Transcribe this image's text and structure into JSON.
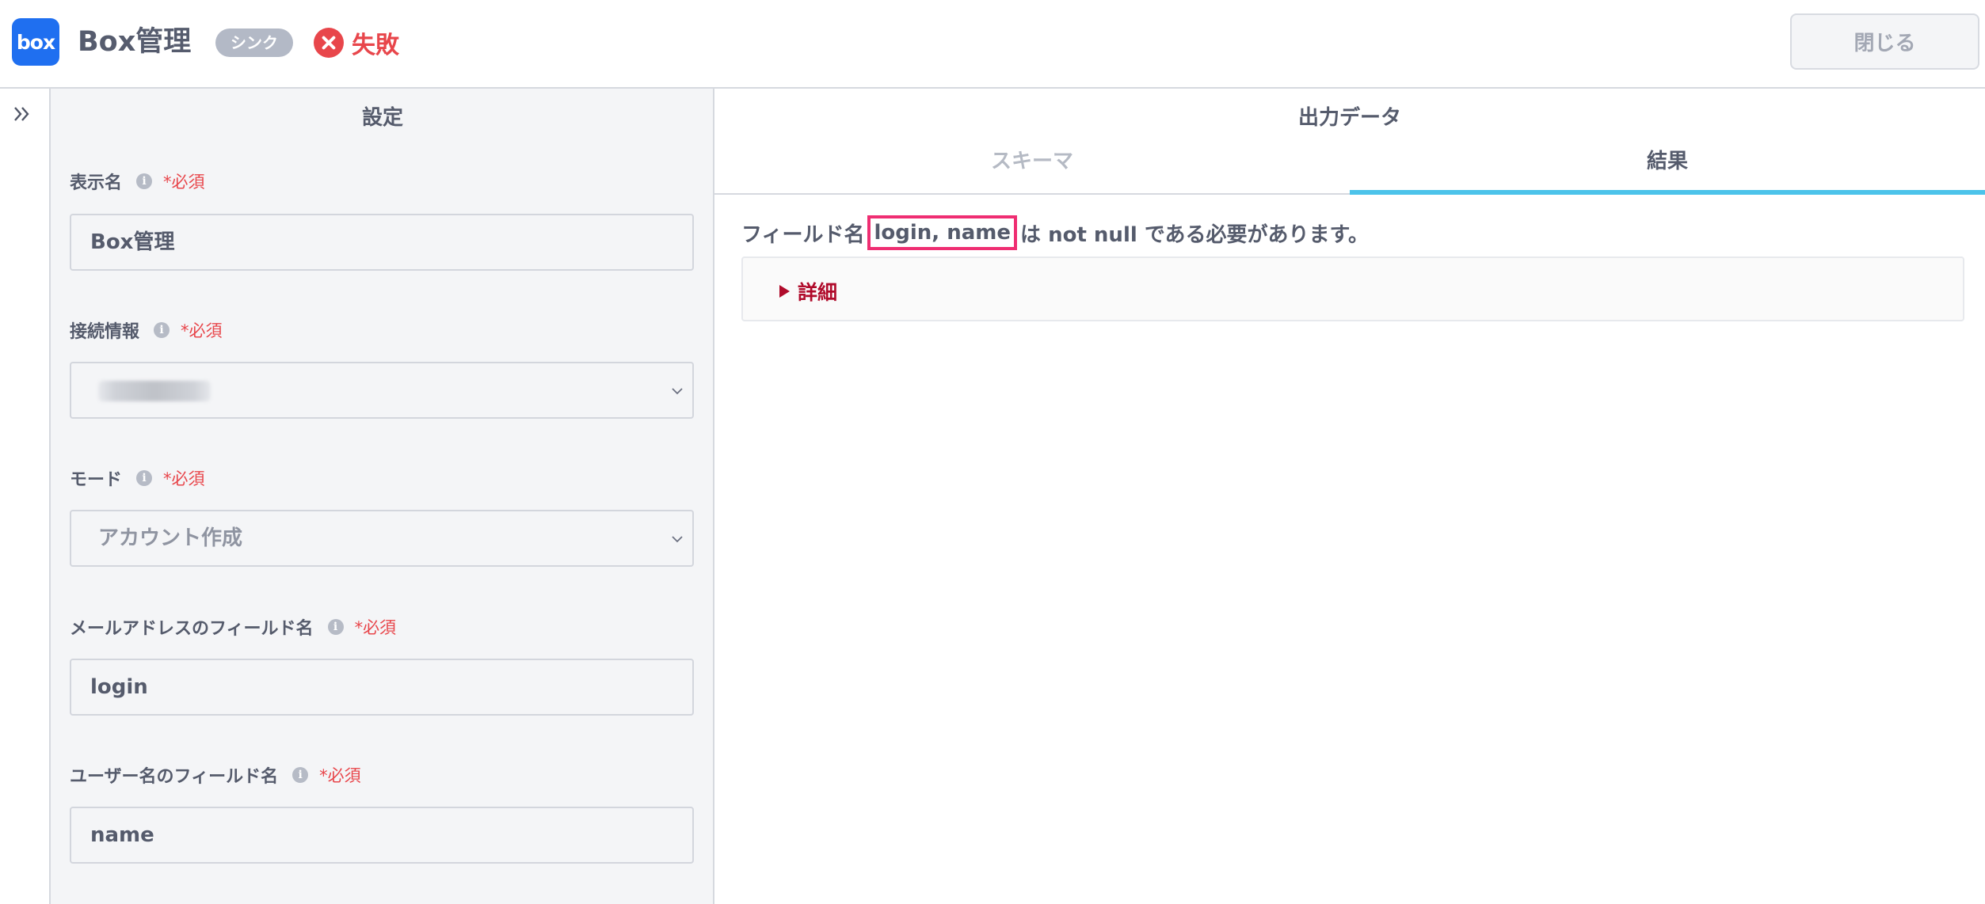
{
  "header": {
    "logo_text": "box",
    "title": "Box管理",
    "badge": "シンク",
    "status": "失敗",
    "close_label": "閉じる"
  },
  "settings": {
    "heading": "設定",
    "required_label": "*必須",
    "fields": [
      {
        "label": "表示名",
        "value": "Box管理",
        "type": "text"
      },
      {
        "label": "接続情報",
        "value": "",
        "type": "select",
        "note": "value obscured"
      },
      {
        "label": "モード",
        "value": "アカウント作成",
        "type": "select"
      },
      {
        "label": "メールアドレスのフィールド名",
        "value": "login",
        "type": "text"
      },
      {
        "label": "ユーザー名のフィールド名",
        "value": "name",
        "type": "text"
      }
    ]
  },
  "output": {
    "heading": "出力データ",
    "tabs": [
      {
        "label": "スキーマ",
        "active": false
      },
      {
        "label": "結果",
        "active": true
      }
    ],
    "message_prefix": "フィールド名",
    "message_highlight": "login, name",
    "message_suffix": "は not null である必要があります。",
    "details_label": "詳細"
  },
  "colors": {
    "accent_tab": "#4cc3ea",
    "error": "#e8464b",
    "highlight_border": "#ef2e72",
    "details_text": "#b00b2b",
    "logo_bg": "#1f6ff0"
  },
  "icons": {
    "fail": "close-circle-icon",
    "expand": "double-chevron-right-icon",
    "info": "info-icon",
    "dropdown": "chevron-down-icon",
    "details": "triangle-right-icon"
  }
}
